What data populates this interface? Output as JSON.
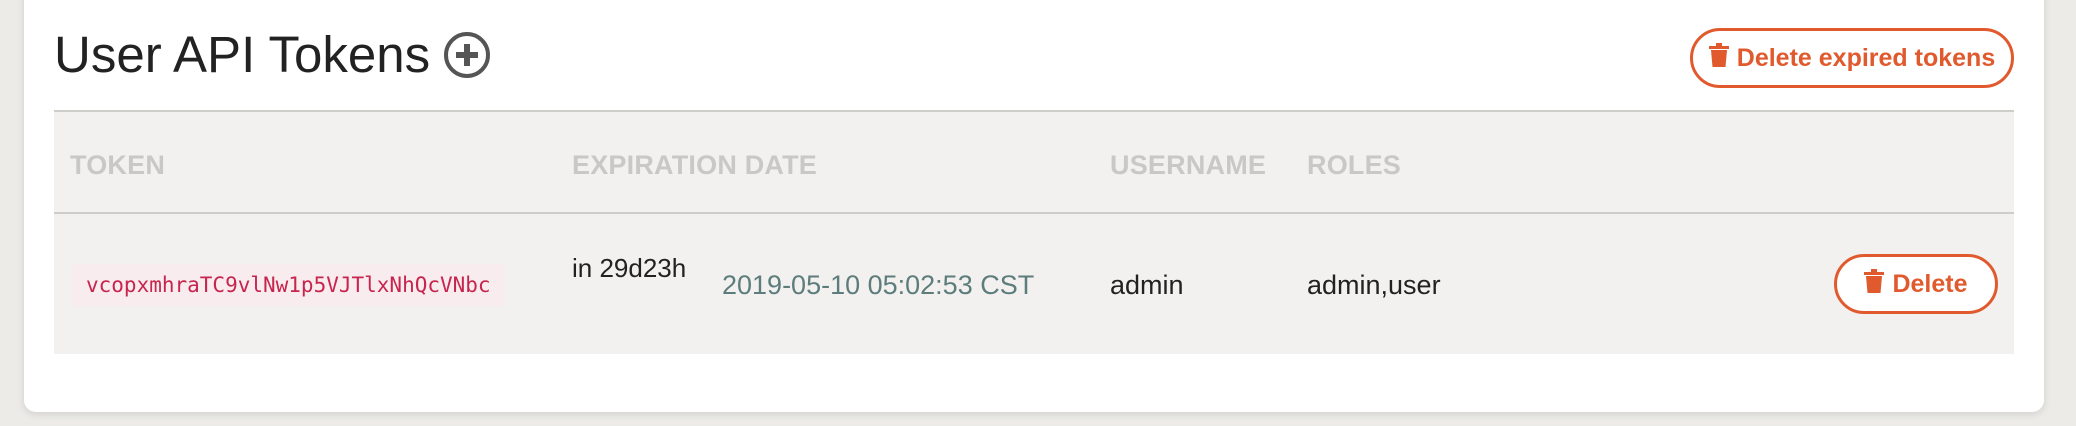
{
  "header": {
    "title": "User API Tokens",
    "delete_expired_label": "Delete expired tokens"
  },
  "table": {
    "columns": [
      "TOKEN",
      "EXPIRATION DATE",
      "USERNAME",
      "ROLES"
    ],
    "rows": [
      {
        "token": "vcopxmhraTC9vlNw1p5VJTlxNhQcVNbc",
        "relative": "in 29d23h",
        "expiration": "2019-05-10 05:02:53 CST",
        "username": "admin",
        "roles": "admin,user",
        "delete_label": "Delete"
      }
    ]
  },
  "colors": {
    "accent": "#e05a2e",
    "token_text": "#c7254e",
    "date_text": "#5d7d7c"
  },
  "icons": [
    "plus-circle-icon",
    "trash-icon"
  ]
}
